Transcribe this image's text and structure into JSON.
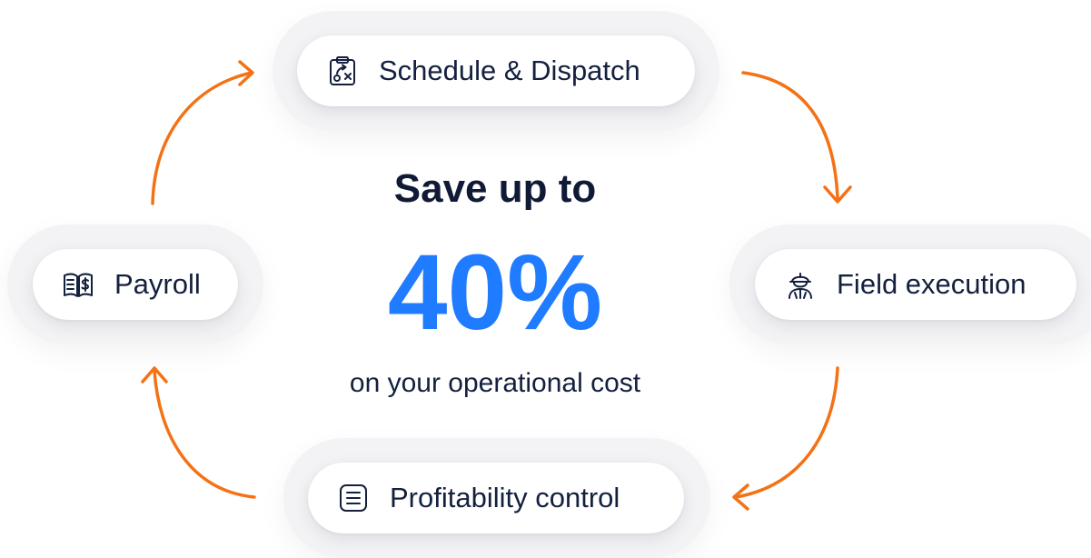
{
  "cycle": {
    "nodes": {
      "schedule": {
        "label": "Schedule & Dispatch",
        "icon": "clipboard-strategy-icon"
      },
      "field": {
        "label": "Field execution",
        "icon": "worker-icon"
      },
      "profit": {
        "label": "Profitability control",
        "icon": "list-document-icon"
      },
      "payroll": {
        "label": "Payroll",
        "icon": "payroll-book-icon"
      }
    },
    "arrow_color": "#f47216"
  },
  "center": {
    "title": "Save up to",
    "value": "40%",
    "subtitle": "on your operational cost",
    "accent_color": "#1f7bff"
  }
}
